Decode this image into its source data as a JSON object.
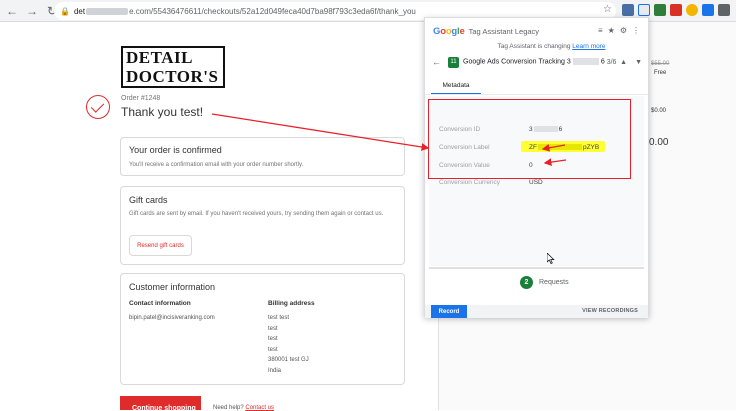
{
  "browser": {
    "url_prefix": "det",
    "url_suffix": "e.com/55436476611/checkouts/52a12d049feca40d7ba98f793c3eda6f/thank_you"
  },
  "page": {
    "logo_text": "DETAIL DOCTOR'S",
    "order_number": "Order #1248",
    "thank_you": "Thank you test!",
    "confirmed": {
      "title": "Your order is confirmed",
      "text": "You'll receive a confirmation email with your order number shortly."
    },
    "gift_cards": {
      "title": "Gift cards",
      "text": "Gift cards are sent by email. If you haven't received yours, try sending them again or contact us.",
      "button": "Resend gift cards"
    },
    "customer": {
      "title": "Customer information",
      "contact_heading": "Contact information",
      "contact_email": "bipin.patel@incisiveranking.com",
      "billing_heading": "Billing address",
      "billing_lines": [
        "test test",
        "test",
        "test",
        "test",
        "380001 test GJ",
        "India"
      ]
    },
    "continue_button": "Continue shopping",
    "help_text": "Need help?",
    "help_link": "Contact us"
  },
  "summary": {
    "strike_price": "$55.00",
    "shipping_value": "Free",
    "tax_value": "$0.00",
    "total_value": "0.00"
  },
  "extension": {
    "brand": "Google",
    "title": "Tag Assistant Legacy",
    "notice_text": "Tag Assistant is changing",
    "notice_link": "Learn more",
    "tag_badge": "11",
    "tag_name": "Google Ads Conversion Tracking",
    "tag_id_start": "3",
    "tag_id_end": "6",
    "pager": "3/6",
    "tab_metadata": "Metadata",
    "fields": [
      {
        "key": "Conversion ID",
        "value_start": "3",
        "value_end": "6"
      },
      {
        "key": "Conversion Label",
        "value_start": "ZF",
        "value_end": "pZYB"
      },
      {
        "key": "Conversion Value",
        "value": "0"
      },
      {
        "key": "Conversion Currency",
        "value": "USD"
      }
    ],
    "requests_count": "2",
    "requests_label": "Requests",
    "record_button": "Record",
    "view_recordings": "VIEW RECORDINGS"
  },
  "colors": {
    "brand_red": "#e02b2b",
    "annotation_red": "#e8202a",
    "tag_green": "#188038",
    "link_blue": "#1a73e8",
    "highlight_yellow": "#ffff33"
  }
}
